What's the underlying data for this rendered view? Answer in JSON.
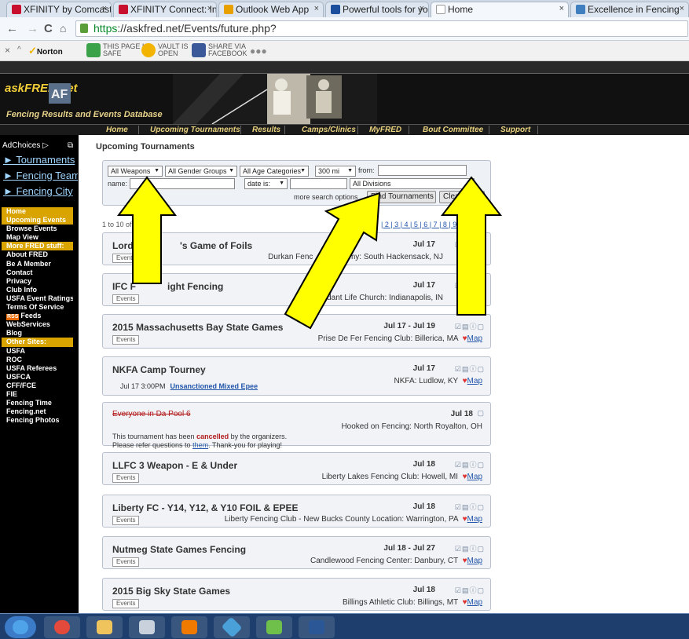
{
  "browser": {
    "tabs": [
      {
        "label": "XFINITY by Comcast",
        "color": "#c8102e"
      },
      {
        "label": "XFINITY Connect: Inb",
        "color": "#c8102e"
      },
      {
        "label": "Outlook Web App",
        "color": "#e8a000"
      },
      {
        "label": "Powerful tools for yo",
        "color": "#1b4f9e"
      },
      {
        "label": "Home",
        "color": "#ffffff"
      },
      {
        "label": "Excellence in Fencing",
        "color": "#3f7fbf"
      }
    ],
    "url_scheme": "https",
    "url_rest": "://askfred.net/Events/future.php?"
  },
  "norton": {
    "brand": "Norton",
    "safe_l1": "THIS PAGE IS",
    "safe_l2": "SAFE",
    "vault_l1": "VAULT IS",
    "vault_l2": "OPEN",
    "share_l1": "SHARE VIA",
    "share_l2": "FACEBOOK"
  },
  "site": {
    "logo": "askFRED.net",
    "tagline": "Fencing Results and Events Database",
    "menu": [
      "Home",
      "Upcoming Tournaments",
      "Results",
      "Camps/Clinics",
      "MyFRED",
      "Bout Committee",
      "Support"
    ]
  },
  "sidebar": {
    "adchoices": "AdChoices",
    "big_links": [
      "► Tournaments",
      "► Fencing Team",
      "► Fencing City"
    ],
    "nav": [
      {
        "label": "Home",
        "hl": true
      },
      {
        "label": "Upcoming Events",
        "hl": true
      },
      {
        "label": "Browse Events",
        "hl": false
      },
      {
        "label": "Map View",
        "hl": false
      },
      {
        "label": "More FRED stuff:",
        "hl": true
      },
      {
        "label": "About FRED",
        "hl": false
      },
      {
        "label": "Be A Member",
        "hl": false
      },
      {
        "label": "Contact",
        "hl": false
      },
      {
        "label": "Privacy",
        "hl": false
      },
      {
        "label": "Club Info",
        "hl": false
      },
      {
        "label": "USFA Event Ratings",
        "hl": false
      },
      {
        "label": "Terms Of Service",
        "hl": false
      },
      {
        "label": "Feeds",
        "hl": false,
        "rss": "RSS"
      },
      {
        "label": "WebServices",
        "hl": false
      },
      {
        "label": "Blog",
        "hl": false
      },
      {
        "label": "Other Sites:",
        "hl": true
      },
      {
        "label": "USFA",
        "hl": false
      },
      {
        "label": "ROC",
        "hl": false
      },
      {
        "label": "USFA Referees",
        "hl": false
      },
      {
        "label": "USFCA",
        "hl": false
      },
      {
        "label": "CFF/FCE",
        "hl": false
      },
      {
        "label": "FIE",
        "hl": false
      },
      {
        "label": "Fencing Time",
        "hl": false
      },
      {
        "label": "Fencing.net",
        "hl": false
      },
      {
        "label": "Fencing Photos",
        "hl": false
      }
    ]
  },
  "main": {
    "title": "Upcoming Tournaments",
    "form": {
      "weapons": "All Weapons",
      "gender": "All Gender Groups",
      "age": "All Age Categories",
      "distance": "300 mi",
      "from_label": "from:",
      "name_label": "name:",
      "date_label": "date is:",
      "divisions": "All Divisions",
      "more_options": "more search options",
      "find_button": "Find Tournaments",
      "clear_button": "Clear"
    },
    "pager_text": "1 to 10 of 2",
    "pages_text": "| 2 | 3 | 4 | 5 | 6 | 7 | 8 | 9"
  },
  "tournaments": [
    {
      "name": "Lord ",
      "name2": "'s Game of Foils",
      "date": "Jul 17",
      "location": "Durkan Fenc",
      "location2": "emy: South Hackensack, NJ",
      "tag": "Events",
      "cancelled": false
    },
    {
      "name": "IFC F",
      "name2": "ight Fencing",
      "date": "Jul 17",
      "location": "dant Life Church: Indianapolis, IN",
      "tag": "Events",
      "cancelled": false
    },
    {
      "name": "2015 Massachusetts Bay State Games",
      "date": "Jul 17 - Jul 19",
      "location": "Prise De Fer Fencing Club: Billerica, MA",
      "tag": "Events",
      "map": "Map",
      "cancelled": false
    },
    {
      "name": "NKFA Camp Tourney",
      "date": "Jul 17",
      "location": "NKFA: Ludlow, KY",
      "map": "Map",
      "event_time": "Jul 17   3:00PM",
      "event_name": "Unsanctioned Mixed Epee",
      "cancelled": false
    },
    {
      "name": "Everyone in Da Pool 6",
      "date": "Jul 18",
      "location": "Hooked on Fencing: North Royalton, OH",
      "cancelled": true,
      "msg1": "This tournament has been ",
      "msg_bold": "cancelled",
      "msg2": " by the organizers.",
      "msg3": "Please refer questions to ",
      "msg_link": "them",
      "msg4": ". Thank-you for playing!"
    },
    {
      "name": "LLFC 3 Weapon - E & Under",
      "date": "Jul 18",
      "location": "Liberty Lakes Fencing Club: Howell, MI",
      "tag": "Events",
      "map": "Map",
      "cancelled": false
    },
    {
      "name": "Liberty FC - Y14, Y12, & Y10 FOIL & EPEE",
      "date": "Jul 18",
      "location": "Liberty Fencing Club - New Bucks County Location: Warrington, PA",
      "tag": "Events",
      "map": "Map",
      "cancelled": false
    },
    {
      "name": "Nutmeg State Games Fencing",
      "date": "Jul 18 - Jul 27",
      "location": "Candlewood Fencing Center: Danbury, CT",
      "tag": "Events",
      "map": "Map",
      "cancelled": false
    },
    {
      "name": "2015 Big Sky State Games",
      "date": "Jul 18",
      "location": "Billings Athletic Club: Billings, MT",
      "tag": "Events",
      "map": "Map",
      "cancelled": false
    }
  ],
  "colors": {
    "arrow_fill": "#ffff00",
    "arrow_stroke": "#000000",
    "highlight": "#d9a400"
  }
}
